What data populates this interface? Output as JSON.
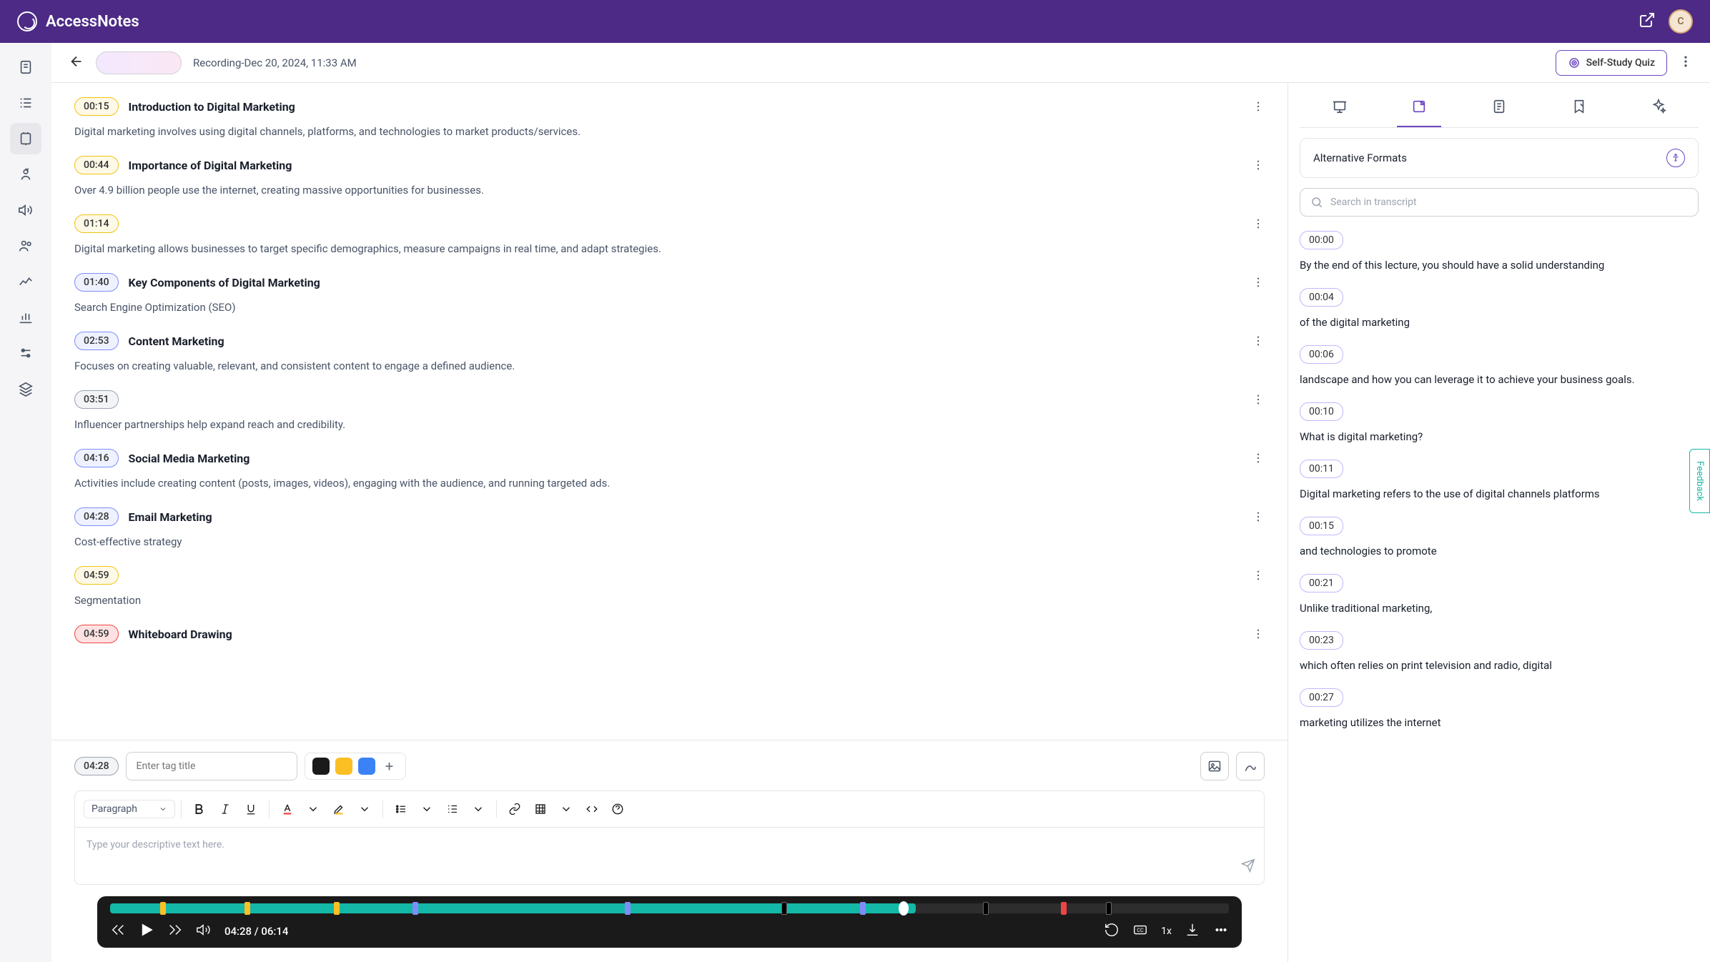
{
  "app": {
    "name": "AccessNotes",
    "avatar_initial": "C"
  },
  "header": {
    "title": "Recording-Dec 20, 2024, 11:33 AM",
    "quiz_label": "Self-Study Quiz"
  },
  "notes": [
    {
      "time": "00:15",
      "color": "yellow",
      "title": "Introduction to Digital Marketing",
      "body": "Digital marketing involves using digital channels, platforms, and technologies to market products/services."
    },
    {
      "time": "00:44",
      "color": "yellow",
      "title": "Importance of Digital Marketing",
      "body": "Over 4.9 billion people use the internet, creating massive opportunities for businesses."
    },
    {
      "time": "01:14",
      "color": "yellow",
      "title": "",
      "body": "Digital marketing allows businesses to target specific demographics, measure campaigns in real time, and adapt strategies."
    },
    {
      "time": "01:40",
      "color": "blue",
      "title": "Key Components of Digital Marketing",
      "body": "Search Engine Optimization (SEO)"
    },
    {
      "time": "02:53",
      "color": "blue",
      "title": "Content Marketing",
      "body": "Focuses on creating valuable, relevant, and consistent content to engage a defined audience."
    },
    {
      "time": "03:51",
      "color": "gray",
      "title": "",
      "body": "Influencer partnerships help expand reach and credibility."
    },
    {
      "time": "04:16",
      "color": "blue",
      "title": "Social Media Marketing",
      "body": "Activities include creating content (posts, images, videos), engaging with the audience, and running targeted ads."
    },
    {
      "time": "04:28",
      "color": "blue",
      "title": "Email Marketing",
      "body": "Cost-effective strategy"
    },
    {
      "time": "04:59",
      "color": "yellow",
      "title": "",
      "body": "Segmentation"
    },
    {
      "time": "04:59",
      "color": "red",
      "title": "Whiteboard Drawing",
      "body": ""
    }
  ],
  "editor": {
    "current_time": "04:28",
    "tag_placeholder": "Enter tag title",
    "paragraph_label": "Paragraph",
    "text_placeholder": "Type your descriptive text here."
  },
  "player": {
    "current": "04:28",
    "total": "06:14",
    "speed": "1x",
    "markers": [
      {
        "pos": 4.5,
        "color": "yellow"
      },
      {
        "pos": 12,
        "color": "yellow"
      },
      {
        "pos": 20,
        "color": "yellow"
      },
      {
        "pos": 27,
        "color": "blue"
      },
      {
        "pos": 46,
        "color": "blue"
      },
      {
        "pos": 60,
        "color": "black"
      },
      {
        "pos": 67,
        "color": "blue"
      },
      {
        "pos": 78,
        "color": "black"
      },
      {
        "pos": 85,
        "color": "red"
      },
      {
        "pos": 89,
        "color": "black"
      }
    ],
    "playhead": 70.5
  },
  "sidepanel": {
    "alt_formats_label": "Alternative Formats",
    "search_placeholder": "Search in transcript",
    "transcript": [
      {
        "time": "00:00",
        "text": "By the end of this lecture, you should have a solid understanding"
      },
      {
        "time": "00:04",
        "text": "of the digital marketing"
      },
      {
        "time": "00:06",
        "text": "landscape and how you can leverage it to achieve your business goals."
      },
      {
        "time": "00:10",
        "text": "What is digital marketing?"
      },
      {
        "time": "00:11",
        "text": "Digital marketing refers to the use of digital channels platforms"
      },
      {
        "time": "00:15",
        "text": "and technologies to promote"
      },
      {
        "time": "00:21",
        "text": "Unlike traditional marketing,"
      },
      {
        "time": "00:23",
        "text": "which often relies on print television and radio, digital"
      },
      {
        "time": "00:27",
        "text": "marketing utilizes the internet"
      }
    ]
  },
  "feedback_label": "Feedback"
}
